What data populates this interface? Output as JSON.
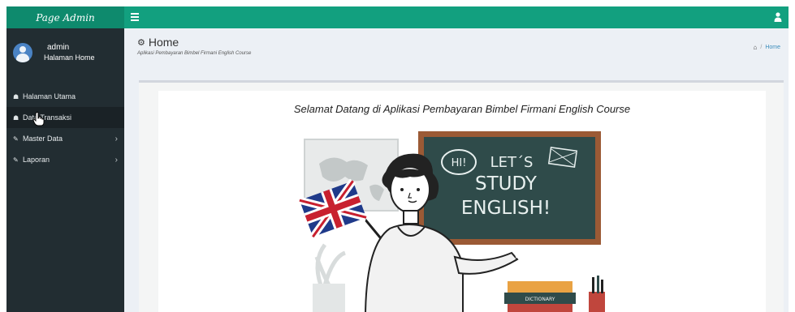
{
  "app": {
    "brand": "Page Admin"
  },
  "user_panel": {
    "name": "admin",
    "role": "Halaman Home"
  },
  "sidebar": {
    "items": [
      {
        "label": "Halaman Utama",
        "icon": "home-icon",
        "has_submenu": false
      },
      {
        "label": "Data Transaksi",
        "icon": "home-icon",
        "has_submenu": false,
        "active": true
      },
      {
        "label": "Master Data",
        "icon": "edit-icon",
        "has_submenu": true
      },
      {
        "label": "Laporan",
        "icon": "edit-icon",
        "has_submenu": true
      }
    ]
  },
  "header": {
    "title": "Home",
    "subtitle": "Aplikasi Pembayaran Bimbel Firmani English Course",
    "breadcrumb_home": "Home",
    "breadcrumb_sep": "/"
  },
  "main": {
    "welcome": "Selamat Datang di Aplikasi Pembayaran Bimbel Firmani English Course",
    "board": {
      "bubble": "HI!",
      "line1": "LET´S",
      "line2": "STUDY",
      "line3": "ENGLISH!"
    },
    "book_label": "DICTIONARY"
  },
  "colors": {
    "topbar": "#12a07f",
    "brand_bg": "#0e8a6d",
    "sidebar_bg": "#222d32",
    "chalkboard": "#2f4b4a",
    "board_frame": "#a0522d"
  },
  "chevron_glyph": "›"
}
